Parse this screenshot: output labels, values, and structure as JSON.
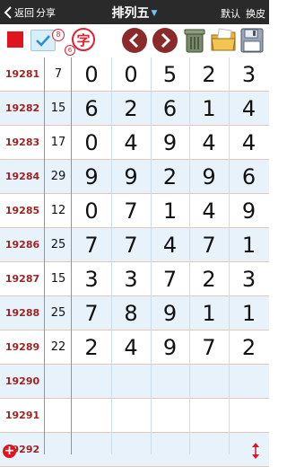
{
  "header": {
    "back_label": "返回",
    "share_label": "分享",
    "title": "排列五",
    "default_label": "默认",
    "skin_label": "换皮"
  },
  "toolbar": {
    "badge_top": "8",
    "badge_bottom": "6",
    "zi_label": "字"
  },
  "colors": {
    "header_bg": "#2a2a2a",
    "issue_text": "#9a2424",
    "row_alt_bg": "#e8f2fb",
    "accent_red": "#e0141e"
  },
  "rows": [
    {
      "issue": "19281",
      "sum": "7",
      "digits": [
        "0",
        "0",
        "5",
        "2",
        "3"
      ]
    },
    {
      "issue": "19282",
      "sum": "15",
      "digits": [
        "6",
        "2",
        "6",
        "1",
        "4"
      ]
    },
    {
      "issue": "19283",
      "sum": "17",
      "digits": [
        "0",
        "4",
        "9",
        "4",
        "4"
      ]
    },
    {
      "issue": "19284",
      "sum": "29",
      "digits": [
        "9",
        "9",
        "2",
        "9",
        "6"
      ]
    },
    {
      "issue": "19285",
      "sum": "12",
      "digits": [
        "0",
        "7",
        "1",
        "4",
        "9"
      ]
    },
    {
      "issue": "19286",
      "sum": "25",
      "digits": [
        "7",
        "7",
        "4",
        "7",
        "1"
      ]
    },
    {
      "issue": "19287",
      "sum": "15",
      "digits": [
        "3",
        "3",
        "7",
        "2",
        "3"
      ]
    },
    {
      "issue": "19288",
      "sum": "25",
      "digits": [
        "7",
        "8",
        "9",
        "1",
        "1"
      ]
    },
    {
      "issue": "19289",
      "sum": "22",
      "digits": [
        "2",
        "4",
        "9",
        "7",
        "2"
      ]
    },
    {
      "issue": "19290",
      "sum": "",
      "digits": [
        "",
        "",
        "",
        "",
        ""
      ]
    },
    {
      "issue": "19291",
      "sum": "",
      "digits": [
        "",
        "",
        "",
        "",
        ""
      ]
    },
    {
      "issue": "19292",
      "sum": "",
      "digits": [
        "",
        "",
        "",
        "",
        ""
      ]
    }
  ]
}
